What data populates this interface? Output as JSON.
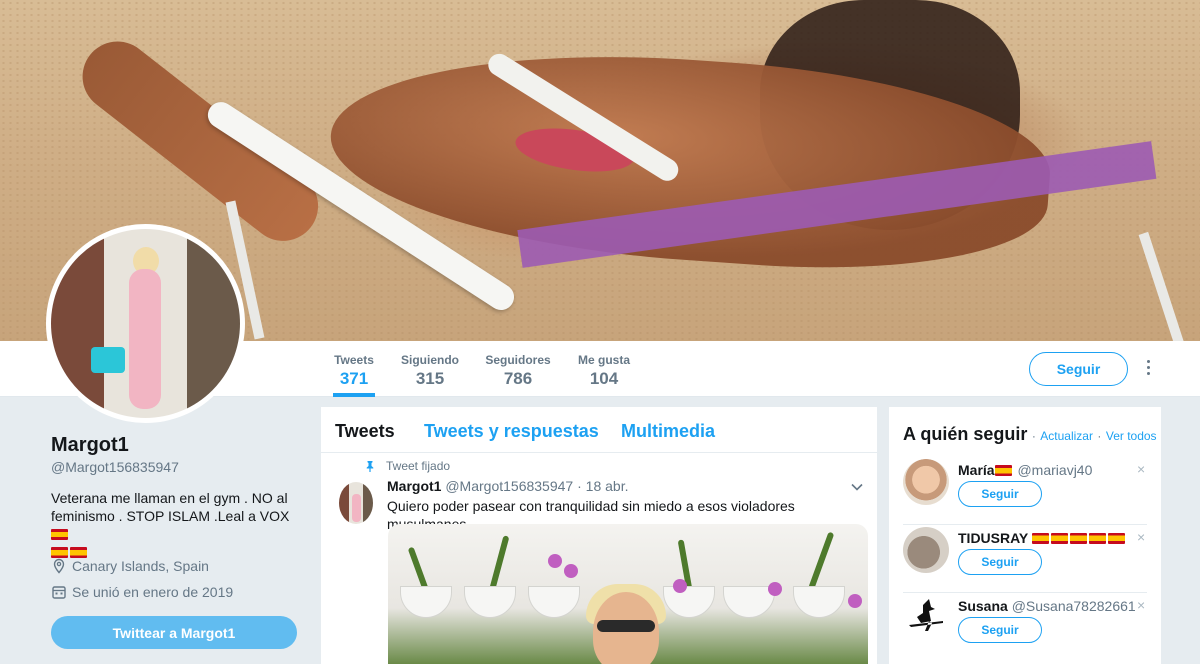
{
  "profile": {
    "name": "Margot1",
    "handle": "@Margot156835947",
    "bio": "Veterana me llaman en el gym . NO al feminismo . STOP ISLAM .Leal a VOX",
    "location": "Canary Islands, Spain",
    "joined": "Se unió en enero de 2019",
    "tweet_to_label": "Twittear a Margot1"
  },
  "stats": [
    {
      "label": "Tweets",
      "value": "371"
    },
    {
      "label": "Siguiendo",
      "value": "315"
    },
    {
      "label": "Seguidores",
      "value": "786"
    },
    {
      "label": "Me gusta",
      "value": "104"
    }
  ],
  "follow_label": "Seguir",
  "timeline": {
    "tabs": [
      "Tweets",
      "Tweets y respuestas",
      "Multimedia"
    ],
    "pinned_label": "Tweet fijado",
    "tweet": {
      "name": "Margot1",
      "handle": "@Margot156835947",
      "dot": "·",
      "date": "18 abr.",
      "text": "Quiero poder pasear con tranquilidad  sin miedo a esos violadores musulmanes"
    }
  },
  "who_to_follow": {
    "title": "A quién seguir",
    "dot": "·",
    "refresh": "Actualizar",
    "view_all": "Ver todos",
    "follow_label": "Seguir",
    "close": "×",
    "items": [
      {
        "name": "María",
        "handle": "@mariavj40",
        "flags": 1
      },
      {
        "name": "TIDUSRAY",
        "handle": "",
        "flags": 5
      },
      {
        "name": "Susana",
        "handle": "@Susana78282661",
        "flags": 0
      }
    ]
  },
  "colors": {
    "accent": "#1da1f2",
    "muted": "#657786",
    "background": "#e6ecf0"
  }
}
